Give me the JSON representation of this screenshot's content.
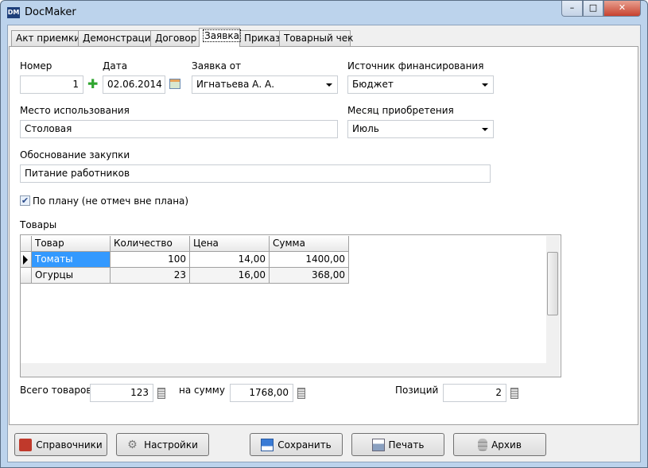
{
  "window": {
    "title": "DocMaker",
    "logo": "DM",
    "controls": {
      "minimize": "–",
      "maximize": "□",
      "close": "✕"
    }
  },
  "tabs": [
    {
      "label": "Акт приемки"
    },
    {
      "label": "Демонстрация"
    },
    {
      "label": "Договор"
    },
    {
      "label": "Заявка",
      "selected": true
    },
    {
      "label": "Приказ"
    },
    {
      "label": "Товарный чек"
    }
  ],
  "form": {
    "number_label": "Номер",
    "number_value": "1",
    "date_label": "Дата",
    "date_value": "02.06.2014",
    "from_label": "Заявка от",
    "from_value": "Игнатьева А. А.",
    "source_label": "Источник финансирования",
    "source_value": "Бюджет",
    "place_label": "Место использования",
    "place_value": "Столовая",
    "month_label": "Месяц приобретения",
    "month_value": "Июль",
    "reason_label": "Обоснование закупки",
    "reason_value": "Питание работников",
    "plan_label": "По плану (не отмеч вне плана)",
    "plan_checked": true
  },
  "goods": {
    "title": "Товары",
    "columns": [
      "Товар",
      "Количество",
      "Цена",
      "Сумма"
    ],
    "rows": [
      [
        "Томаты",
        "100",
        "14,00",
        "1400,00"
      ],
      [
        "Огурцы",
        "23",
        "16,00",
        "368,00"
      ]
    ]
  },
  "totals": {
    "total_label": "Всего товаров",
    "total_value": "123",
    "sum_label": "на сумму",
    "sum_value": "1768,00",
    "positions_label": "Позиций",
    "positions_value": "2"
  },
  "buttons": {
    "refs": "Справочники",
    "settings": "Настройки",
    "save": "Сохранить",
    "print": "Печать",
    "archive": "Архив"
  },
  "colors": {
    "selection": "#3399ff",
    "frame": "#bcd3ec"
  }
}
